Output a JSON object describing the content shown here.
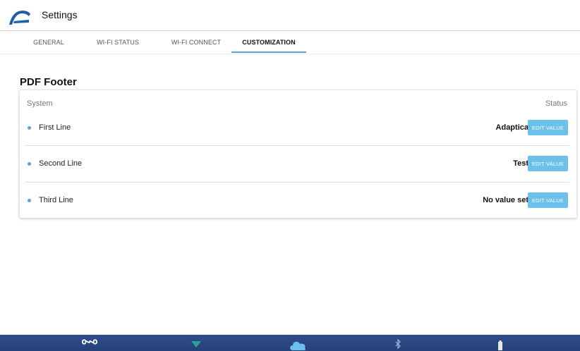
{
  "header": {
    "title": "Settings",
    "logo_icon": "adaptica-arc-logo"
  },
  "tabs": [
    {
      "label": "GENERAL",
      "active": false
    },
    {
      "label": "WI-FI STATUS",
      "active": false
    },
    {
      "label": "WI-FI CONNECT",
      "active": false
    },
    {
      "label": "CUSTOMIZATION",
      "active": true
    }
  ],
  "section": {
    "title": "PDF Footer"
  },
  "table": {
    "col_system": "System",
    "col_status": "Status",
    "rows": [
      {
        "label": "First Line",
        "value": "Adaptica",
        "button": "EDIT VALUE"
      },
      {
        "label": "Second Line",
        "value": "Test",
        "button": "EDIT VALUE"
      },
      {
        "label": "Third Line",
        "value": "No value set",
        "button": "EDIT VALUE"
      }
    ]
  },
  "bottom_bar": {
    "icons": [
      "infinity-icon",
      "wifi-icon",
      "cloud-icon",
      "bluetooth-icon",
      "battery-icon"
    ]
  },
  "colors": {
    "accent": "#5aa7d6",
    "button": "#6cc0ec",
    "bottom_bar": "#2f4d8a"
  }
}
